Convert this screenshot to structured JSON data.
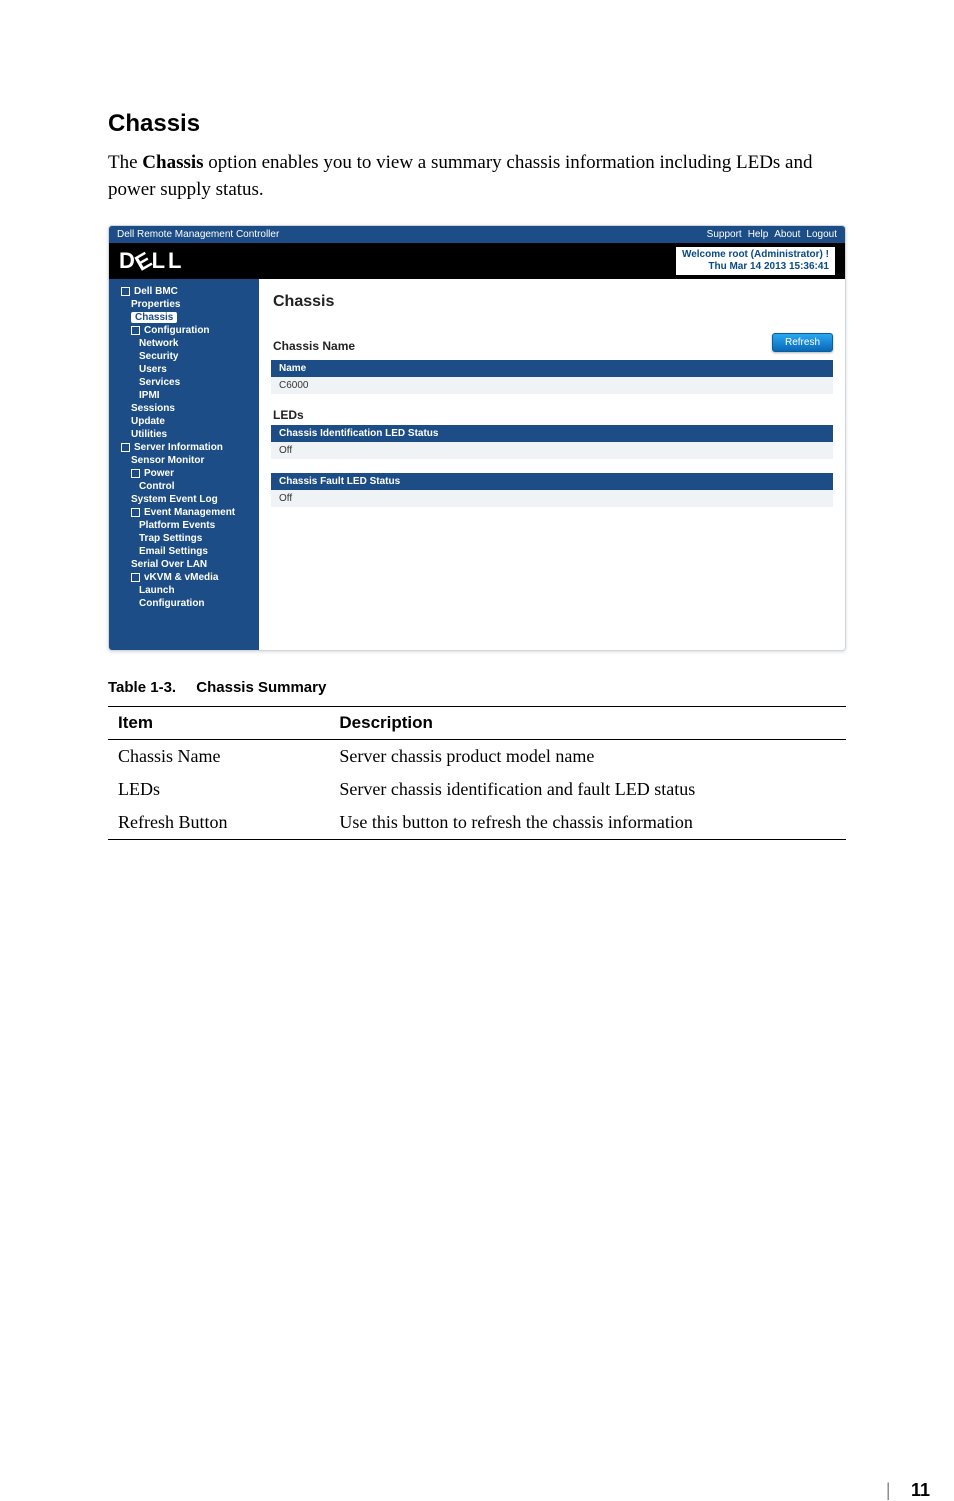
{
  "section": {
    "title": "Chassis",
    "intro_before_bold": "The ",
    "intro_bold": "Chassis",
    "intro_after_bold": " option enables you to view a summary chassis information including LEDs and power supply status."
  },
  "screenshot": {
    "titlebar": {
      "left": "Dell Remote Management Controller",
      "links": [
        "Support",
        "Help",
        "About",
        "Logout"
      ]
    },
    "welcome": {
      "line1": "Welcome root (Administrator) !",
      "line2": "Thu Mar 14 2013 15:36:41"
    },
    "sidebar": [
      {
        "label": "Dell BMC",
        "level": 1,
        "toggle": true
      },
      {
        "label": "Properties",
        "level": 2
      },
      {
        "label": "Chassis",
        "level": 2,
        "active": true
      },
      {
        "label": "Configuration",
        "level": 2,
        "toggle": true
      },
      {
        "label": "Network",
        "level": 3
      },
      {
        "label": "Security",
        "level": 3
      },
      {
        "label": "Users",
        "level": 3
      },
      {
        "label": "Services",
        "level": 3
      },
      {
        "label": "IPMI",
        "level": 3
      },
      {
        "label": "Sessions",
        "level": 2
      },
      {
        "label": "Update",
        "level": 2
      },
      {
        "label": "Utilities",
        "level": 2
      },
      {
        "label": "Server Information",
        "level": 1,
        "toggle": true
      },
      {
        "label": "Sensor Monitor",
        "level": 2
      },
      {
        "label": "Power",
        "level": 2,
        "toggle": true
      },
      {
        "label": "Control",
        "level": 3
      },
      {
        "label": "System Event Log",
        "level": 2
      },
      {
        "label": "Event Management",
        "level": 2,
        "toggle": true
      },
      {
        "label": "Platform Events",
        "level": 3
      },
      {
        "label": "Trap Settings",
        "level": 3
      },
      {
        "label": "Email Settings",
        "level": 3
      },
      {
        "label": "Serial Over LAN",
        "level": 2
      },
      {
        "label": "vKVM & vMedia",
        "level": 2,
        "toggle": true
      },
      {
        "label": "Launch",
        "level": 3
      },
      {
        "label": "Configuration",
        "level": 3
      }
    ],
    "main": {
      "heading": "Chassis",
      "refresh_label": "Refresh",
      "chassis_name_label": "Chassis Name",
      "chassis_name_header": "Name",
      "chassis_name_value": "C6000",
      "leds_label": "LEDs",
      "led_id_header": "Chassis Identification LED Status",
      "led_id_value": "Off",
      "led_fault_header": "Chassis Fault LED Status",
      "led_fault_value": "Off"
    }
  },
  "table_caption": {
    "num": "Table 1-3.",
    "label": "Chassis Summary"
  },
  "table_headers": {
    "item": "Item",
    "desc": "Description"
  },
  "table_rows": [
    {
      "item": "Chassis Name",
      "desc": "Server chassis product model name"
    },
    {
      "item": "LEDs",
      "desc": "Server chassis identification and fault LED status"
    },
    {
      "item": "Refresh Button",
      "desc": "Use this button to refresh the chassis information"
    }
  ],
  "page_number": "11"
}
